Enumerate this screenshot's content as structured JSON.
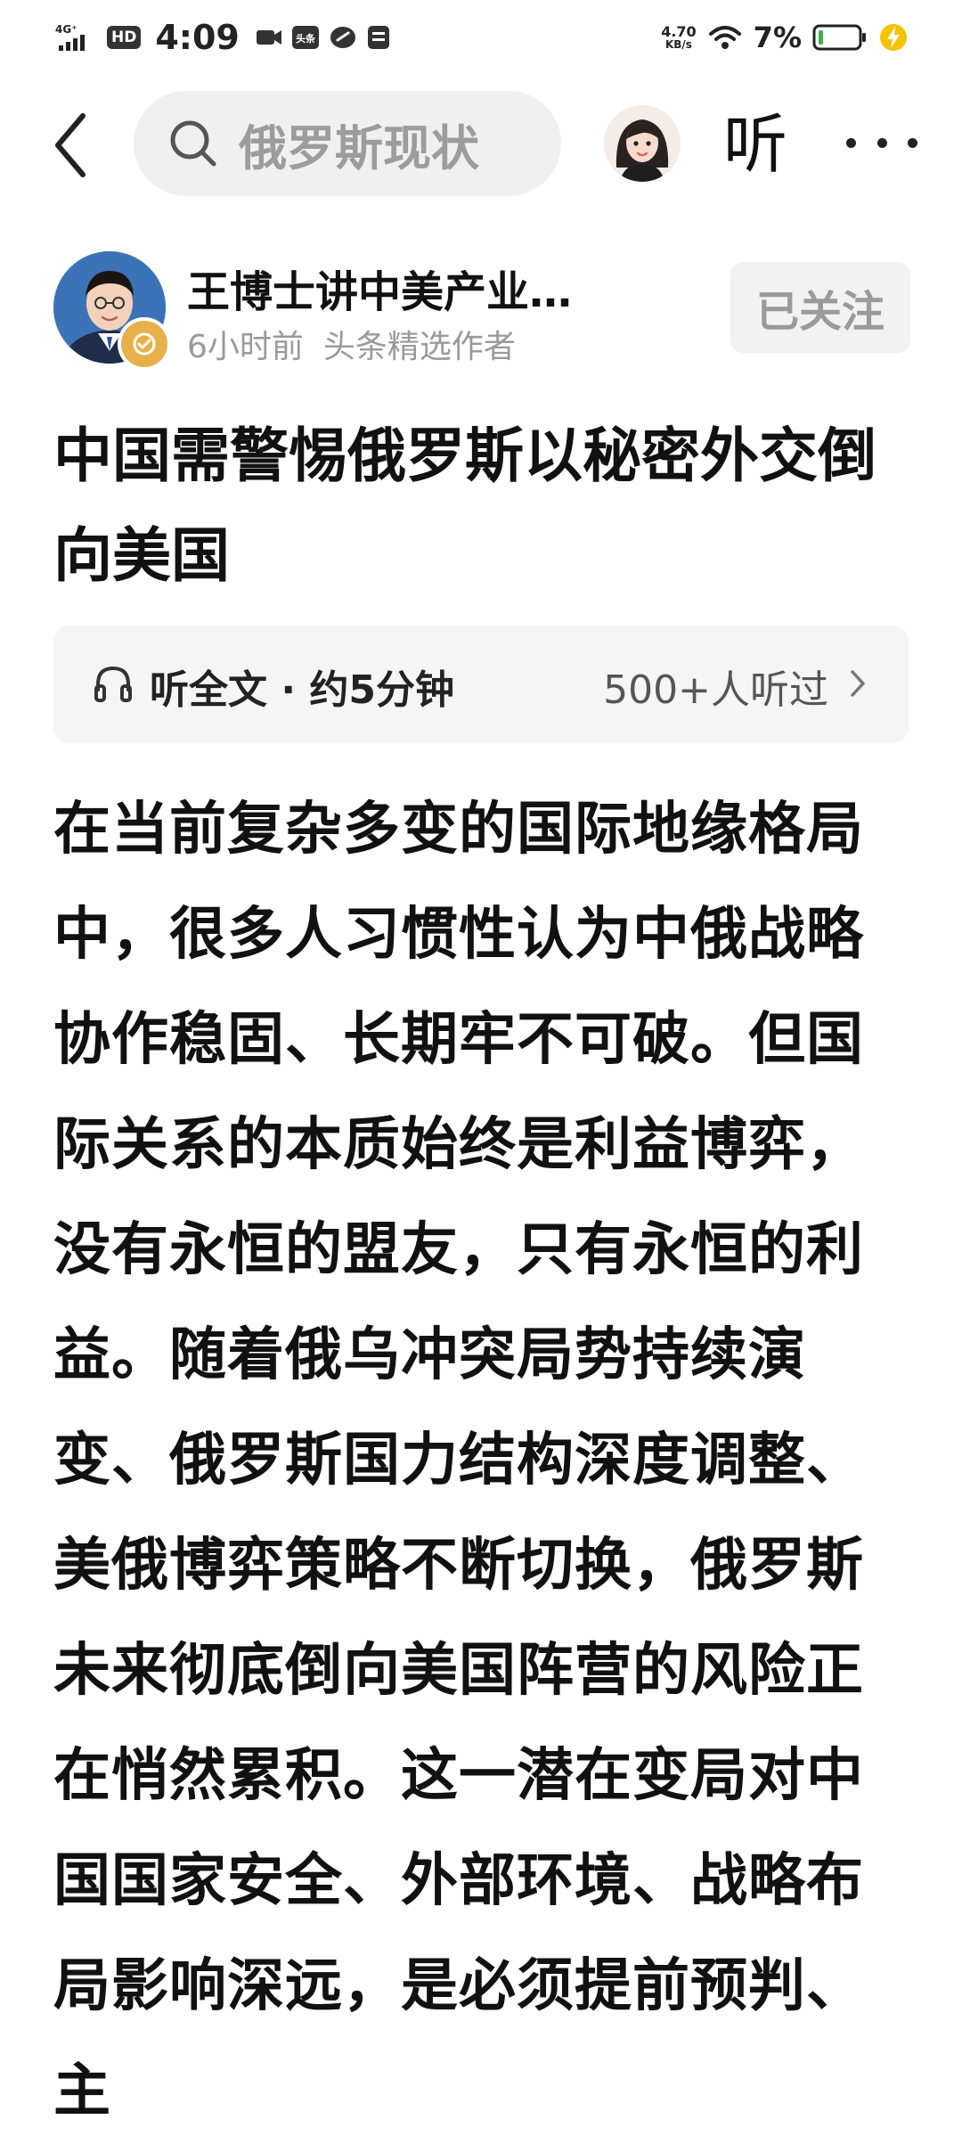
{
  "status_bar": {
    "network": "4G",
    "hd": "HD",
    "time": "4:09",
    "speed_value": "4.70",
    "speed_unit": "KB/s",
    "battery": "7%"
  },
  "nav": {
    "search_text": "俄罗斯现状",
    "listen_label": "听"
  },
  "author": {
    "name": "王博士讲中美产业…",
    "time_ago": "6小时前",
    "tag": "头条精选作者",
    "follow_label": "已关注"
  },
  "article": {
    "title": "中国需警惕俄罗斯以秘密外交倒向美国",
    "listen_full": "听全文 · 约5分钟",
    "listen_count": "500+人听过",
    "body": "在当前复杂多变的国际地缘格局中，很多人习惯性认为中俄战略协作稳固、长期牢不可破。但国际关系的本质始终是利益博弈，没有永恒的盟友，只有永恒的利益。随着俄乌冲突局势持续演变、俄罗斯国力结构深度调整、美俄博弈策略不断切换，俄罗斯未来彻底倒向美国阵营的风险正在悄然累积。这一潜在变局对中国国家安全、外部环境、战略布局影响深远，是必须提前预判、主"
  },
  "colors": {
    "accent_badge": "#e8b04a",
    "muted_text": "#9a9a9a",
    "panel_bg": "#f5f5f5"
  },
  "icons": [
    "back-arrow-icon",
    "search-icon",
    "headphone-icon",
    "chevron-right-icon",
    "more-icon",
    "wifi-icon",
    "battery-icon",
    "charging-icon",
    "signal-icon"
  ]
}
